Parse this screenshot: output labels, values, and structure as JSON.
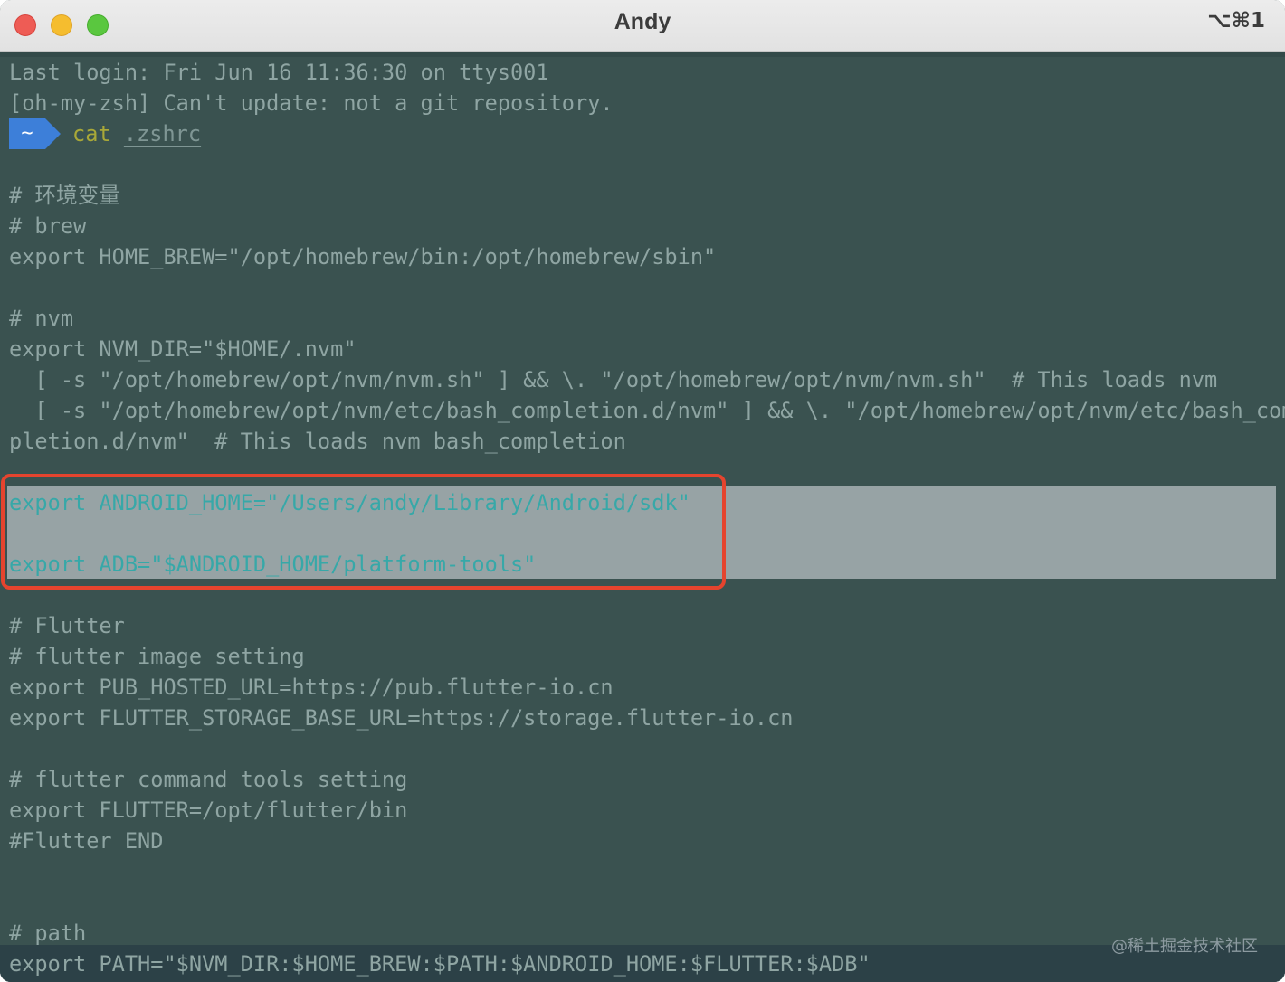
{
  "window": {
    "title": "Andy",
    "shortcut": "⌥⌘1"
  },
  "terminal": {
    "prompt_symbol": "~",
    "command": "cat",
    "command_arg": ".zshrc",
    "lines": [
      "Last login: Fri Jun 16 11:36:30 on ttys001",
      "[oh-my-zsh] Can't update: not a git repository.",
      "",
      "",
      "# 环境变量",
      "# brew",
      "export HOME_BREW=\"/opt/homebrew/bin:/opt/homebrew/sbin\"",
      "",
      "# nvm",
      "export NVM_DIR=\"$HOME/.nvm\"",
      "  [ -s \"/opt/homebrew/opt/nvm/nvm.sh\" ] && \\. \"/opt/homebrew/opt/nvm/nvm.sh\"  # This loads nvm",
      "  [ -s \"/opt/homebrew/opt/nvm/etc/bash_completion.d/nvm\" ] && \\. \"/opt/homebrew/opt/nvm/etc/bash_com",
      "pletion.d/nvm\"  # This loads nvm bash_completion",
      "",
      "export ANDROID_HOME=\"/Users/andy/Library/Android/sdk\"",
      "",
      "export ADB=\"$ANDROID_HOME/platform-tools\"",
      "",
      "# Flutter",
      "# flutter image setting",
      "export PUB_HOSTED_URL=https://pub.flutter-io.cn",
      "export FLUTTER_STORAGE_BASE_URL=https://storage.flutter-io.cn",
      "",
      "# flutter command tools setting",
      "export FLUTTER=/opt/flutter/bin",
      "#Flutter END",
      "",
      "",
      "# path",
      "export PATH=\"$NVM_DIR:$HOME_BREW:$PATH:$ANDROID_HOME:$FLUTTER:$ADB\""
    ]
  },
  "watermark": "@稀土掘金技术社区",
  "colors": {
    "terminal_bg": "#3a5250",
    "text": "#8fa5a3",
    "highlight_bg": "#97a3a5",
    "highlight_text": "#37a8a8",
    "annotation_red": "#e5442e",
    "prompt_blue": "#3d7fd9"
  }
}
